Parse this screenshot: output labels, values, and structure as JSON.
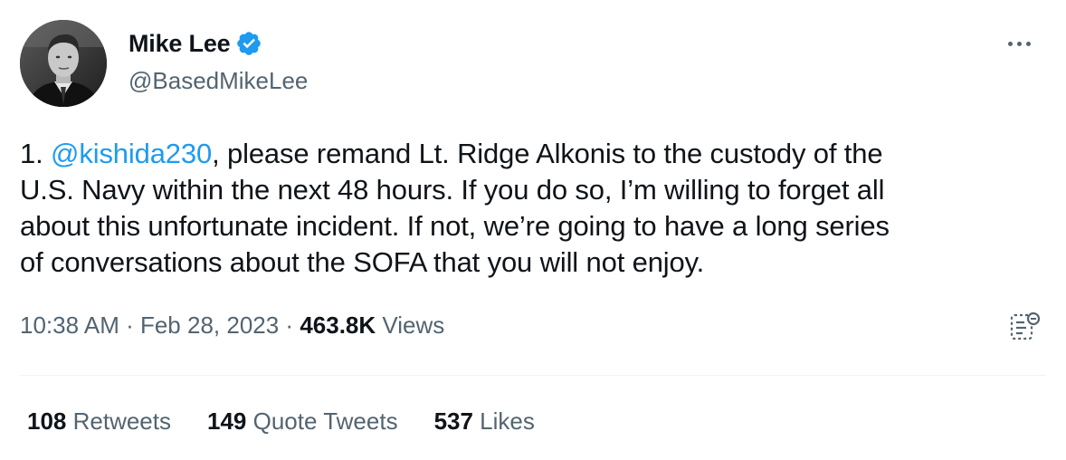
{
  "author": {
    "display_name": "Mike Lee",
    "handle": "@BasedMikeLee",
    "verified_color": "#1d9bf0"
  },
  "menu": {
    "icon": "more-horizontal-icon"
  },
  "tweet": {
    "prefix": "1. ",
    "mention": "@kishida230",
    "line1_rest": ", please remand Lt. Ridge Alkonis to the custody of the",
    "line2": "U.S. Navy within the next 48 hours. If you do so, I’m willing to forget all",
    "line3": "about this unfortunate incident. If not, we’re going to have a long series",
    "line4": "of conversations about the SOFA that you will not enjoy."
  },
  "meta": {
    "time": "10:38 AM",
    "separator": " · ",
    "date": "Feb 28, 2023",
    "views_count": "463.8K",
    "views_label": " Views",
    "analytics_icon": "analytics-icon"
  },
  "stats": {
    "retweets_count": "108",
    "retweets_label": " Retweets",
    "quotes_count": "149",
    "quotes_label": " Quote Tweets",
    "likes_count": "537",
    "likes_label": " Likes"
  },
  "colors": {
    "accent": "#1d9bf0",
    "text_primary": "#0f1419",
    "text_secondary": "#536471",
    "divider": "#eff3f4"
  }
}
